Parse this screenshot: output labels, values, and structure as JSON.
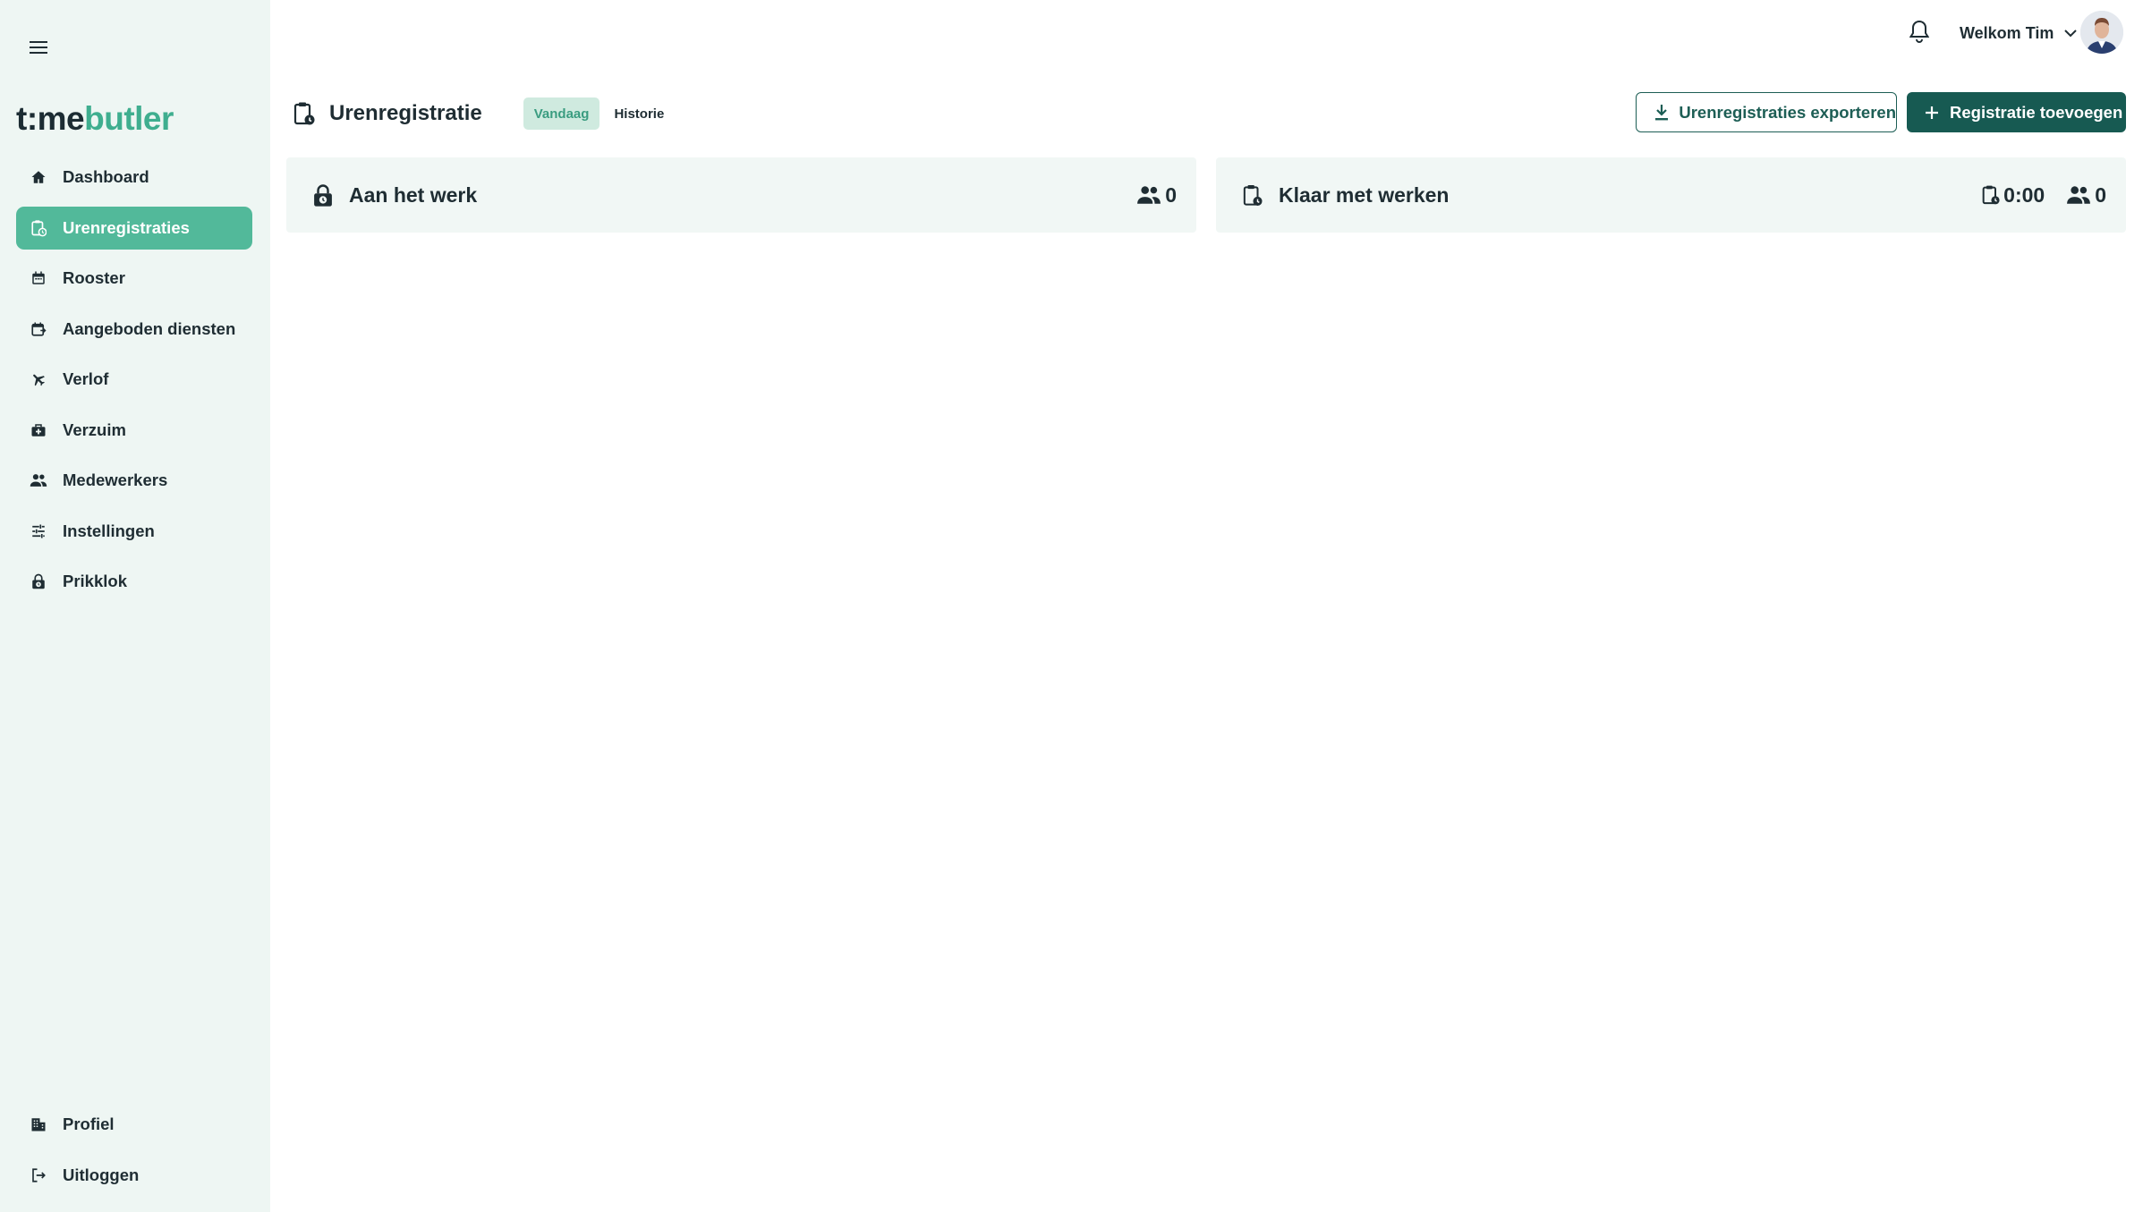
{
  "brand": {
    "logo_part1": "t:me",
    "logo_part2": "butler",
    "accent": "#52b99a",
    "dark_accent": "#175a52"
  },
  "sidebar": {
    "items": [
      {
        "label": "Dashboard",
        "icon": "home-icon"
      },
      {
        "label": "Urenregistraties",
        "icon": "clipboard-clock-icon",
        "active": true
      },
      {
        "label": "Rooster",
        "icon": "calendar-icon"
      },
      {
        "label": "Aangeboden diensten",
        "icon": "calendar-swap-icon"
      },
      {
        "label": "Verlof",
        "icon": "airplane-icon"
      },
      {
        "label": "Verzuim",
        "icon": "medical-bag-icon"
      },
      {
        "label": "Medewerkers",
        "icon": "users-icon"
      },
      {
        "label": "Instellingen",
        "icon": "sliders-icon"
      },
      {
        "label": "Prikklok",
        "icon": "lock-clock-icon"
      }
    ],
    "bottom_items": [
      {
        "label": "Profiel",
        "icon": "building-icon"
      },
      {
        "label": "Uitloggen",
        "icon": "logout-icon"
      }
    ]
  },
  "header": {
    "welcome": "Welkom Tim"
  },
  "page": {
    "title": "Urenregistratie",
    "tabs": [
      {
        "label": "Vandaag",
        "active": true
      },
      {
        "label": "Historie",
        "active": false
      }
    ],
    "export_button": "Urenregistraties exporteren",
    "add_button": "Registratie toevoegen"
  },
  "panels": {
    "working": {
      "title": "Aan het werk",
      "people_count": "0"
    },
    "done": {
      "title": "Klaar met werken",
      "hours": "0:00",
      "people_count": "0"
    }
  }
}
